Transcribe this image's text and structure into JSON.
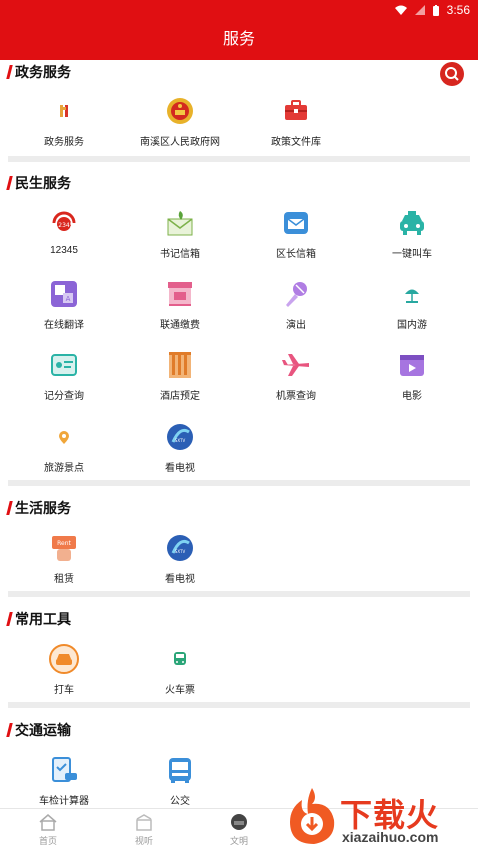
{
  "status_bar": {
    "time": "3:56",
    "icons": [
      "wifi-icon",
      "signal-icon",
      "battery-icon"
    ]
  },
  "header": {
    "title": "服务"
  },
  "sections": {
    "gov": {
      "title": "政务服务",
      "items": [
        {
          "label": "政务服务",
          "icon": "gov-service-icon"
        },
        {
          "label": "南溪区人民政府网",
          "icon": "national-emblem-icon"
        },
        {
          "label": "政策文件库",
          "icon": "briefcase-icon"
        }
      ]
    },
    "livelihood": {
      "title": "民生服务",
      "items": [
        {
          "label": "12345",
          "icon": "hotline-12345-icon"
        },
        {
          "label": "书记信箱",
          "icon": "secretary-mailbox-icon"
        },
        {
          "label": "区长信箱",
          "icon": "mayor-mailbox-icon"
        },
        {
          "label": "一键叫车",
          "icon": "taxi-icon"
        },
        {
          "label": "在线翻译",
          "icon": "translate-icon"
        },
        {
          "label": "联通缴费",
          "icon": "store-icon"
        },
        {
          "label": "演出",
          "icon": "microphone-icon"
        },
        {
          "label": "国内游",
          "icon": "beach-umbrella-icon"
        },
        {
          "label": "记分查询",
          "icon": "license-card-icon"
        },
        {
          "label": "酒店预定",
          "icon": "hotel-icon"
        },
        {
          "label": "机票查询",
          "icon": "airplane-icon"
        },
        {
          "label": "电影",
          "icon": "movie-icon"
        },
        {
          "label": "旅游景点",
          "icon": "location-pin-icon"
        },
        {
          "label": "看电视",
          "icon": "tv-logo-icon"
        }
      ]
    },
    "life": {
      "title": "生活服务",
      "items": [
        {
          "label": "租赁",
          "icon": "rent-sign-icon"
        },
        {
          "label": "看电视",
          "icon": "tv-logo-icon"
        }
      ]
    },
    "tools": {
      "title": "常用工具",
      "items": [
        {
          "label": "打车",
          "icon": "taxi-circle-icon"
        },
        {
          "label": "火车票",
          "icon": "train-icon"
        }
      ]
    },
    "transport": {
      "title": "交通运输",
      "items": [
        {
          "label": "车检计算器",
          "icon": "vehicle-inspection-icon"
        },
        {
          "label": "公交",
          "icon": "bus-icon"
        }
      ]
    }
  },
  "tabbar": {
    "tabs": [
      {
        "label": "首页",
        "icon": "home-icon"
      },
      {
        "label": "视听",
        "icon": "media-icon"
      },
      {
        "label": "文明",
        "icon": "civilization-icon"
      }
    ]
  },
  "watermark": {
    "cn": "下载火",
    "en": "xiazaihuo.com"
  },
  "colors": {
    "brand_red": "#e00f12",
    "divider": "#ececec",
    "tab_text": "#999999"
  }
}
